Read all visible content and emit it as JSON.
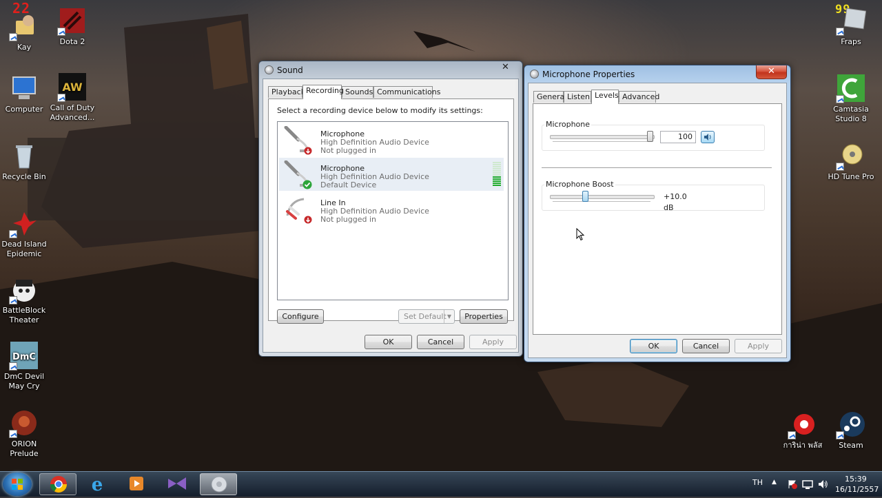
{
  "desktop": {
    "icons_left": [
      {
        "label": "Kay",
        "icon": "user-folder-icon"
      },
      {
        "label": "Dota 2",
        "icon": "dota2-icon"
      },
      {
        "label": "Computer",
        "icon": "computer-icon"
      },
      {
        "label": "Call of Duty Advanced...",
        "icon": "call-of-duty-icon"
      },
      {
        "label": "Recycle Bin",
        "icon": "recycle-bin-icon"
      },
      {
        "label": "Dead Island Epidemic",
        "icon": "dead-island-icon"
      },
      {
        "label": "BattleBlock Theater",
        "icon": "battleblock-icon"
      },
      {
        "label": "DmC Devil May Cry",
        "icon": "dmc-icon"
      },
      {
        "label": "ORION Prelude",
        "icon": "orion-icon"
      }
    ],
    "icons_right": [
      {
        "label": "Fraps",
        "icon": "fraps-icon"
      },
      {
        "label": "Camtasia Studio 8",
        "icon": "camtasia-icon"
      },
      {
        "label": "HD Tune Pro",
        "icon": "hdtune-icon"
      },
      {
        "label": "การิน่า พลัส",
        "icon": "garena-icon"
      },
      {
        "label": "Steam",
        "icon": "steam-icon"
      }
    ],
    "fps_left": "22",
    "fps_right": "99"
  },
  "sound_window": {
    "title": "Sound",
    "tabs": [
      "Playback",
      "Recording",
      "Sounds",
      "Communications"
    ],
    "selected_tab": "Recording",
    "instruction": "Select a recording device below to modify its settings:",
    "devices": [
      {
        "name": "Microphone",
        "driver": "High Definition Audio Device",
        "status": "Not plugged in",
        "icon": "microphone-icon",
        "badge": "unplugged-icon"
      },
      {
        "name": "Microphone",
        "driver": "High Definition Audio Device",
        "status": "Default Device",
        "icon": "microphone-icon",
        "badge": "default-check-icon"
      },
      {
        "name": "Line In",
        "driver": "High Definition Audio Device",
        "status": "Not plugged in",
        "icon": "line-in-cable-icon",
        "badge": "unplugged-icon"
      }
    ],
    "buttons": {
      "configure": "Configure",
      "set_default": "Set Default",
      "properties": "Properties",
      "ok": "OK",
      "cancel": "Cancel",
      "apply": "Apply"
    }
  },
  "mic_window": {
    "title": "Microphone Properties",
    "tabs": [
      "General",
      "Listen",
      "Levels",
      "Advanced"
    ],
    "selected_tab": "Levels",
    "microphone": {
      "label": "Microphone",
      "value": "100",
      "level": 100
    },
    "boost": {
      "label": "Microphone Boost",
      "value": "+10.0 dB",
      "level": 0.33
    },
    "buttons": {
      "ok": "OK",
      "cancel": "Cancel",
      "apply": "Apply"
    }
  },
  "taskbar": {
    "language": "TH",
    "time": "15:39",
    "date": "16/11/2557",
    "items": [
      "start-orb-icon",
      "chrome-icon",
      "internet-explorer-icon",
      "media-player-icon",
      "visual-studio-icon",
      "sound-icon"
    ]
  },
  "colors": {
    "accent": "#3c7fb1",
    "meter_green": "#1eab2a",
    "close_red": "#c2331c"
  }
}
